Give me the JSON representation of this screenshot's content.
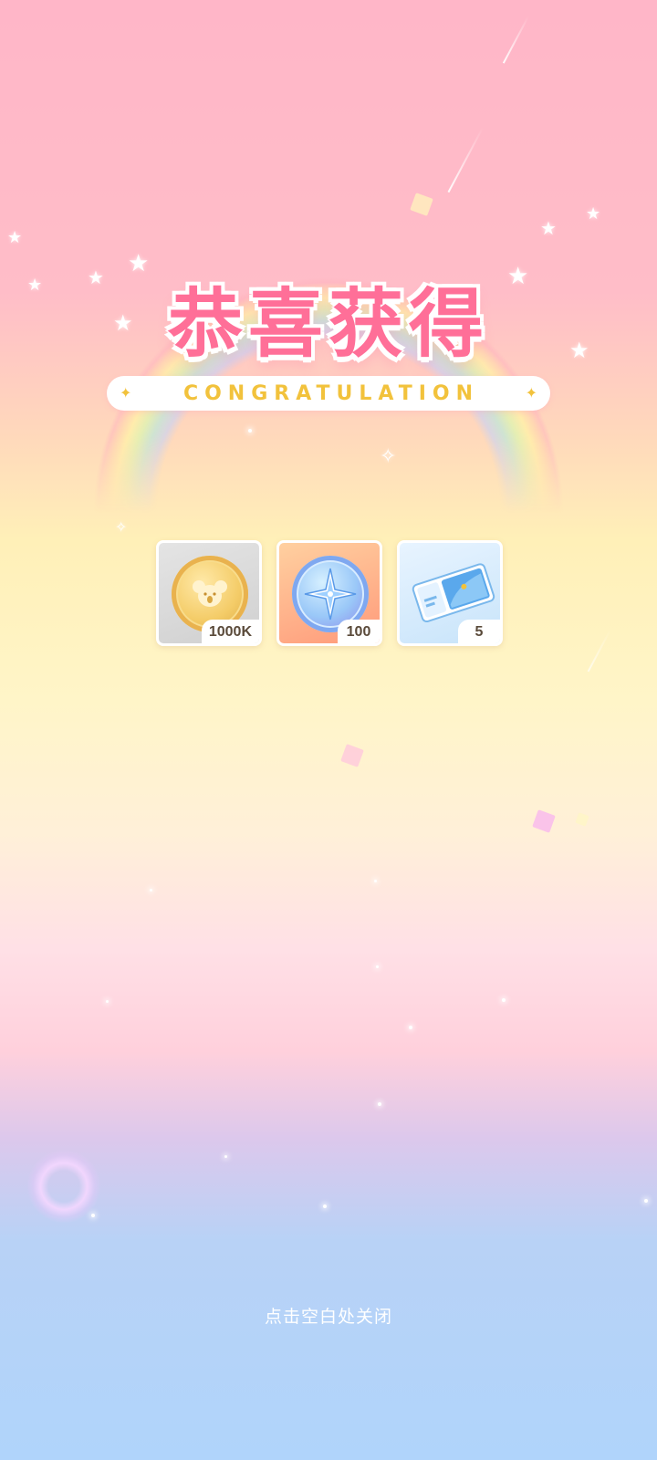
{
  "title": "恭喜获得",
  "subtitle": "CONGRATULATION",
  "rewards": [
    {
      "name": "koala-gold-coin",
      "quantity": "1000K"
    },
    {
      "name": "star-compass-medal",
      "quantity": "100"
    },
    {
      "name": "blue-ticket",
      "quantity": "5"
    }
  ],
  "hint": "点击空白处关闭",
  "colors": {
    "title_pink": "#ff6f98",
    "subtitle_gold": "#f2c23c",
    "bg_top_pink": "#ffb6c8",
    "bg_bottom_blue": "#b0d4fb"
  }
}
